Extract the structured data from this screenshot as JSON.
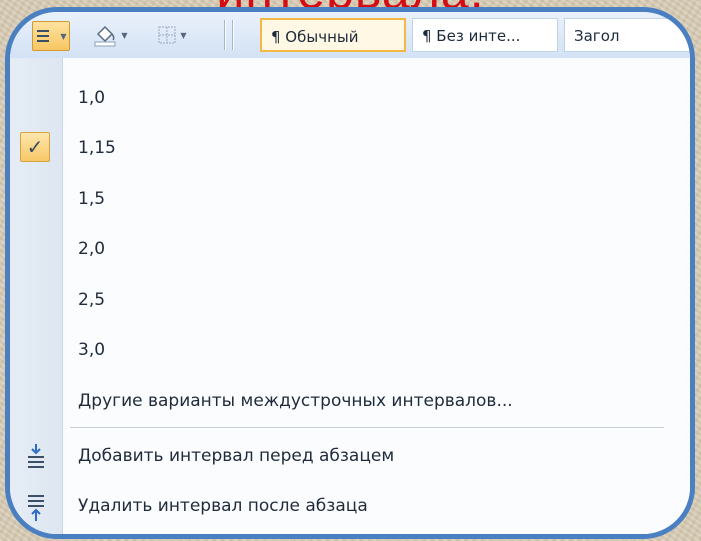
{
  "slide": {
    "title": "интервала."
  },
  "toolbar": {
    "styles": [
      "¶ Обычный",
      "¶ Без инте...",
      "Загол"
    ]
  },
  "line_spacing_menu": {
    "options": [
      "1,0",
      "1,15",
      "1,5",
      "2,0",
      "2,5",
      "3,0"
    ],
    "selected": "1,15",
    "more_options": "Другие варианты междустрочных интервалов...",
    "add_space_before": "Добавить интервал перед абзацем",
    "remove_space_after": "Удалить интервал после абзаца"
  },
  "colors": {
    "title": "#d30d12",
    "frame_border": "#4a7fc1",
    "selected_highlight": "#f8c867"
  }
}
